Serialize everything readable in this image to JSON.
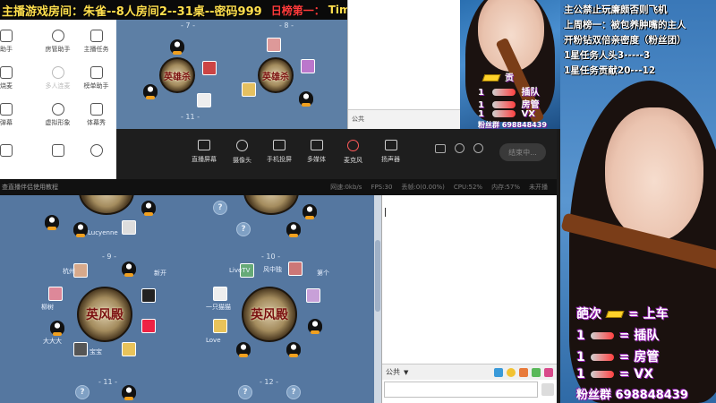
{
  "banner": {
    "room": "主播游戏房间：朱雀--8人房间2--31桌--密码999",
    "rank_label": "日榜第一：",
    "rank_name": "TimorTui"
  },
  "tool_panel": {
    "items": [
      {
        "label": "助手",
        "icon": "helper-icon"
      },
      {
        "label": "房管助手",
        "icon": "user-admin-icon"
      },
      {
        "label": "主播任务",
        "icon": "task-icon"
      },
      {
        "label": "烧麦",
        "icon": "item-icon"
      },
      {
        "label": "多人连麦",
        "icon": "multi-mic-icon"
      },
      {
        "label": "榜单助手",
        "icon": "rank-icon"
      },
      {
        "label": "弹幕",
        "icon": "danmaku-icon"
      },
      {
        "label": "虚拟形象",
        "icon": "avatar-icon"
      },
      {
        "label": "体幕秀",
        "icon": "show-icon"
      },
      {
        "label": "",
        "icon": "misc-icon"
      },
      {
        "label": "",
        "icon": "gift-icon"
      },
      {
        "label": "",
        "icon": "fire-icon"
      }
    ]
  },
  "controls": {
    "items": [
      {
        "label": "直播屏幕",
        "icon": "screen-icon"
      },
      {
        "label": "摄像头",
        "icon": "camera-icon"
      },
      {
        "label": "手机投屏",
        "icon": "phone-cast-icon"
      },
      {
        "label": "多媒体",
        "icon": "media-icon"
      },
      {
        "label": "麦克风",
        "icon": "microphone-icon"
      },
      {
        "label": "扬声器",
        "icon": "speaker-icon"
      }
    ],
    "end_button": "结束中..."
  },
  "status": {
    "tip": "查直播伴侣使用教程",
    "stats": [
      "网速:0kb/s",
      "FPS:30",
      "丢帧:0(0.00%)",
      "CPU:52%",
      "内存:57%",
      "未开播"
    ]
  },
  "chat": {
    "channel_label": "公共"
  },
  "tables": {
    "top": [
      "- 7 -",
      "- 8 -",
      "- 11 -"
    ],
    "main": [
      "- 9 -",
      "- 10 -",
      "- 11 -",
      "- 12 -"
    ]
  },
  "players": {
    "p1": "Lucyenne",
    "p2": "杭州",
    "p3": "新开",
    "p4": "柳树",
    "p5": "大大大",
    "p6": "宝宝",
    "p7": "一只猫猫",
    "p8": "LiveTV",
    "p9": "第个",
    "p10": "风中独",
    "p11": "Love"
  },
  "cam_overlay": {
    "line1": "贡",
    "line2": "插队",
    "line3": "房管",
    "line4": "VX",
    "line5": "粉丝群 698848439"
  },
  "overlay_rules": {
    "r1": "主公禁止玩廉颇否则飞机",
    "r2": "上周榜一：被包养肿嘴的主人",
    "r3": "开粉钻双倍亲密度（粉丝团）",
    "r4": "1星任务人头3-----3",
    "r5": "1星任务贡献20---12"
  },
  "overlay_rewards": {
    "a_left": "葩次",
    "a_right": "= 上车",
    "b_left": "1",
    "b_right": "= 插队",
    "c_left": "1",
    "c_right": "= 房管",
    "d_left": "1",
    "d_right": "= VX",
    "fans": "粉丝群 698848439"
  },
  "colors": {
    "banner_text": "#ffdf4d",
    "rank_text": "#ff3a3a",
    "game_bg": "#5577a0",
    "accent_purple": "#8a1aa8"
  }
}
